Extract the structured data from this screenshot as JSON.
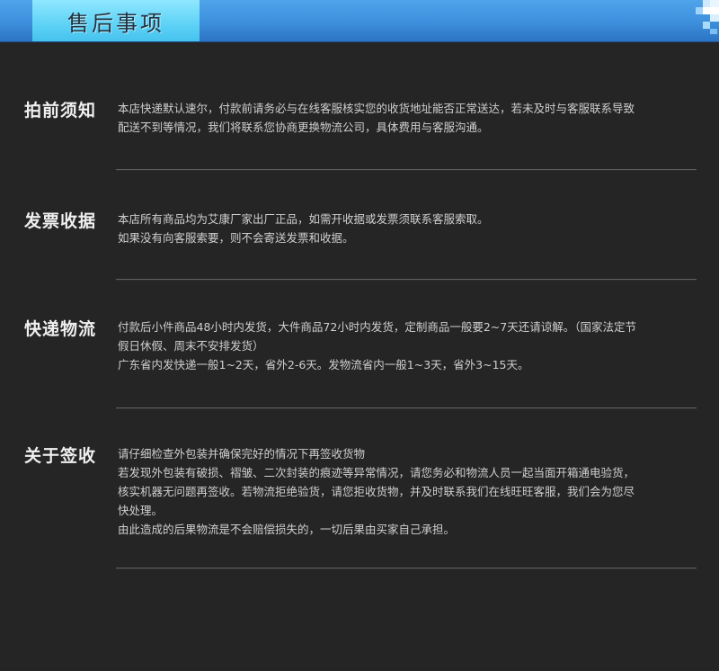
{
  "header": {
    "title": "售后事项"
  },
  "sections": [
    {
      "title": "拍前须知",
      "lines": [
        "本店快递默认速尔，付款前请务必与在线客服核实您的收货地址能否正常送达，若未及时与客服联系导致",
        "配送不到等情况，我们将联系您协商更换物流公司，具体费用与客服沟通。"
      ]
    },
    {
      "title": "发票收据",
      "lines": [
        "本店所有商品均为艾康厂家出厂正品，如需开收据或发票须联系客服索取。",
        "如果没有向客服索要，则不会寄送发票和收据。"
      ]
    },
    {
      "title": "快递物流",
      "lines": [
        "付款后小件商品48小时内发货，大件商品72小时内发货，定制商品一般要2~7天还请谅解。（国家法定节",
        "假日休假、周末不安排发货）",
        "广东省内发快递一般1~2天，省外2-6天。发物流省内一般1~3天，省外3~15天。"
      ]
    },
    {
      "title": "关于签收",
      "lines": [
        "请仔细检查外包装并确保完好的情况下再签收货物",
        "若发现外包装有破损、褶皱、二次封装的痕迹等异常情况，请您务必和物流人员一起当面开箱通电验货，",
        "核实机器无问题再签收。若物流拒绝验货，请您拒收货物，并及时联系我们在线旺旺客服，我们会为您尽",
        "快处理。",
        "由此造成的后果物流是不会赔偿损失的，一切后果由买家自己承担。"
      ]
    }
  ]
}
